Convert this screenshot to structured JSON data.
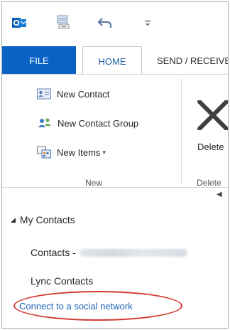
{
  "qat": {
    "icons": [
      "outlook-icon",
      "send-receive-icon",
      "undo-icon",
      "customize-dropdown-icon"
    ]
  },
  "tabs": [
    {
      "label": "FILE"
    },
    {
      "label": "HOME"
    },
    {
      "label": "SEND / RECEIVE"
    }
  ],
  "ribbon": {
    "new_group": {
      "new_contact": "New Contact",
      "new_contact_group": "New Contact Group",
      "new_items": "New Items",
      "label": "New"
    },
    "delete_group": {
      "delete": "Delete",
      "label": "Delete"
    }
  },
  "nav": {
    "section": "My Contacts",
    "items": {
      "contacts": "Contacts -",
      "lync": "Lync Contacts"
    },
    "connect_link": "Connect to a social network"
  },
  "colors": {
    "file_tab": "#0a63c4",
    "link": "#1d63b8",
    "highlight": "#d33a30"
  }
}
